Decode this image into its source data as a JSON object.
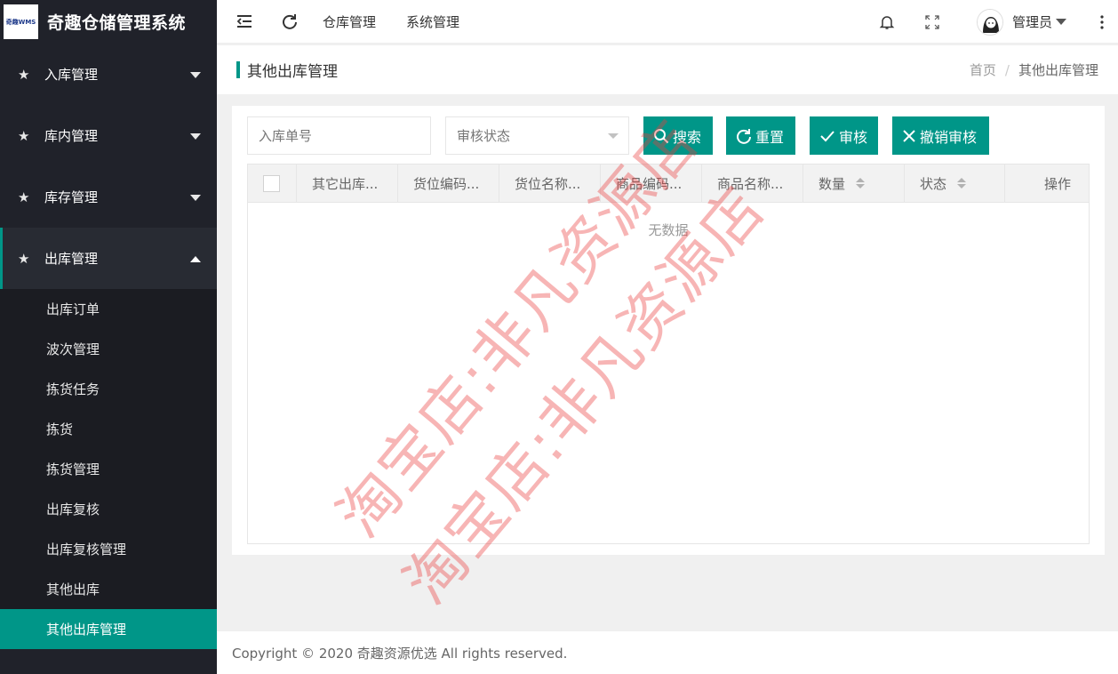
{
  "app": {
    "logo_text": "奇趣WMS",
    "title": "奇趣仓储管理系统"
  },
  "sidebar": {
    "menus": [
      {
        "label": "入库管理"
      },
      {
        "label": "库内管理"
      },
      {
        "label": "库存管理"
      },
      {
        "label": "出库管理"
      }
    ],
    "submenu": [
      {
        "label": "出库订单"
      },
      {
        "label": "波次管理"
      },
      {
        "label": "拣货任务"
      },
      {
        "label": "拣货"
      },
      {
        "label": "拣货管理"
      },
      {
        "label": "出库复核"
      },
      {
        "label": "出库复核管理"
      },
      {
        "label": "其他出库"
      },
      {
        "label": "其他出库管理"
      }
    ]
  },
  "header": {
    "nav": [
      "仓库管理",
      "系统管理"
    ],
    "user": "管理员"
  },
  "page": {
    "title": "其他出库管理",
    "breadcrumb": [
      "首页",
      "其他出库管理"
    ]
  },
  "toolbar": {
    "order_placeholder": "入库单号",
    "status_placeholder": "审核状态",
    "search_label": "搜索",
    "reset_label": "重置",
    "audit_label": "审核",
    "cancel_audit_label": "撤销审核"
  },
  "table": {
    "columns": [
      "其它出库...",
      "货位编码...",
      "货位名称...",
      "商品编码...",
      "商品名称...",
      "数量",
      "状态",
      "操作"
    ],
    "empty_text": "无数据"
  },
  "footer": {
    "copyright": "Copyright © 2020 奇趣资源优选 All rights reserved."
  },
  "watermark": {
    "text": "淘宝店:非凡资源店"
  },
  "colors": {
    "primary": "#009688",
    "sidebar_bg": "#20222a",
    "watermark": "#eb3c3c"
  }
}
